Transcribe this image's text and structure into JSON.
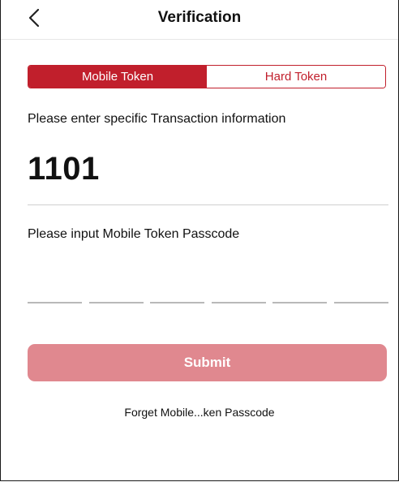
{
  "header": {
    "title": "Verification",
    "back_icon": "chevron-left-icon"
  },
  "token_tabs": [
    {
      "label": "Mobile Token",
      "selected": true
    },
    {
      "label": "Hard Token",
      "selected": false
    }
  ],
  "transaction": {
    "prompt": "Please enter specific Transaction information",
    "code": "1101"
  },
  "passcode": {
    "prompt": "Please input Mobile Token Passcode",
    "digit_count": 6,
    "entered": ""
  },
  "submit": {
    "label": "Submit",
    "enabled": false
  },
  "forget_link": "Forget Mobile...ken Passcode",
  "colors": {
    "accent": "#c11f2c",
    "submit_disabled": "#e0888f",
    "divider": "#cfcfcf"
  }
}
